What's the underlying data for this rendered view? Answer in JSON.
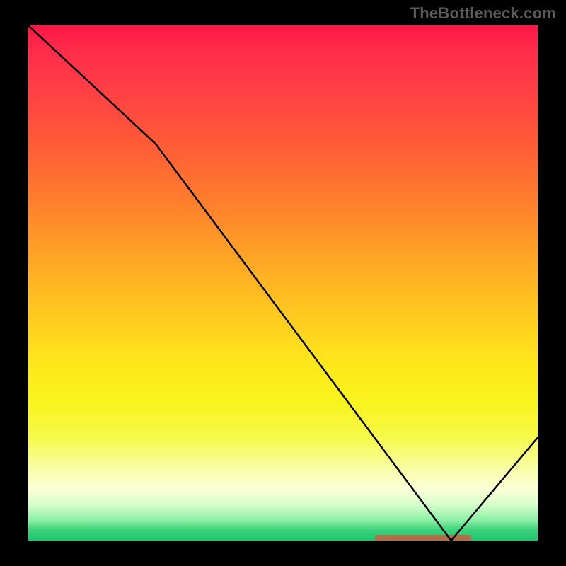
{
  "attribution": "TheBottleneck.com",
  "colors": {
    "frame_background": "#000000",
    "attribution_text": "#5a5a5a",
    "curve_stroke": "#000000",
    "optimal_marker": "#dc503c",
    "gradient_stops": [
      "#ff1744",
      "#ff2d4a",
      "#ff3e45",
      "#ff5838",
      "#ff7a2d",
      "#ffa526",
      "#ffc91f",
      "#ffe61c",
      "#f9f41d",
      "#f6fa4a",
      "#f9ffb5",
      "#fbffd7",
      "#d8ffcd",
      "#8cf0a5",
      "#3ad178",
      "#1ec76e"
    ]
  },
  "chart_data": {
    "type": "line",
    "title": "",
    "xlabel": "",
    "ylabel": "",
    "x": [
      0,
      25,
      83,
      100
    ],
    "values": [
      100,
      77,
      0,
      20
    ],
    "xlim": [
      0,
      100
    ],
    "ylim": [
      0,
      100
    ],
    "optimal_range_x": [
      68,
      87
    ],
    "annotations": []
  }
}
